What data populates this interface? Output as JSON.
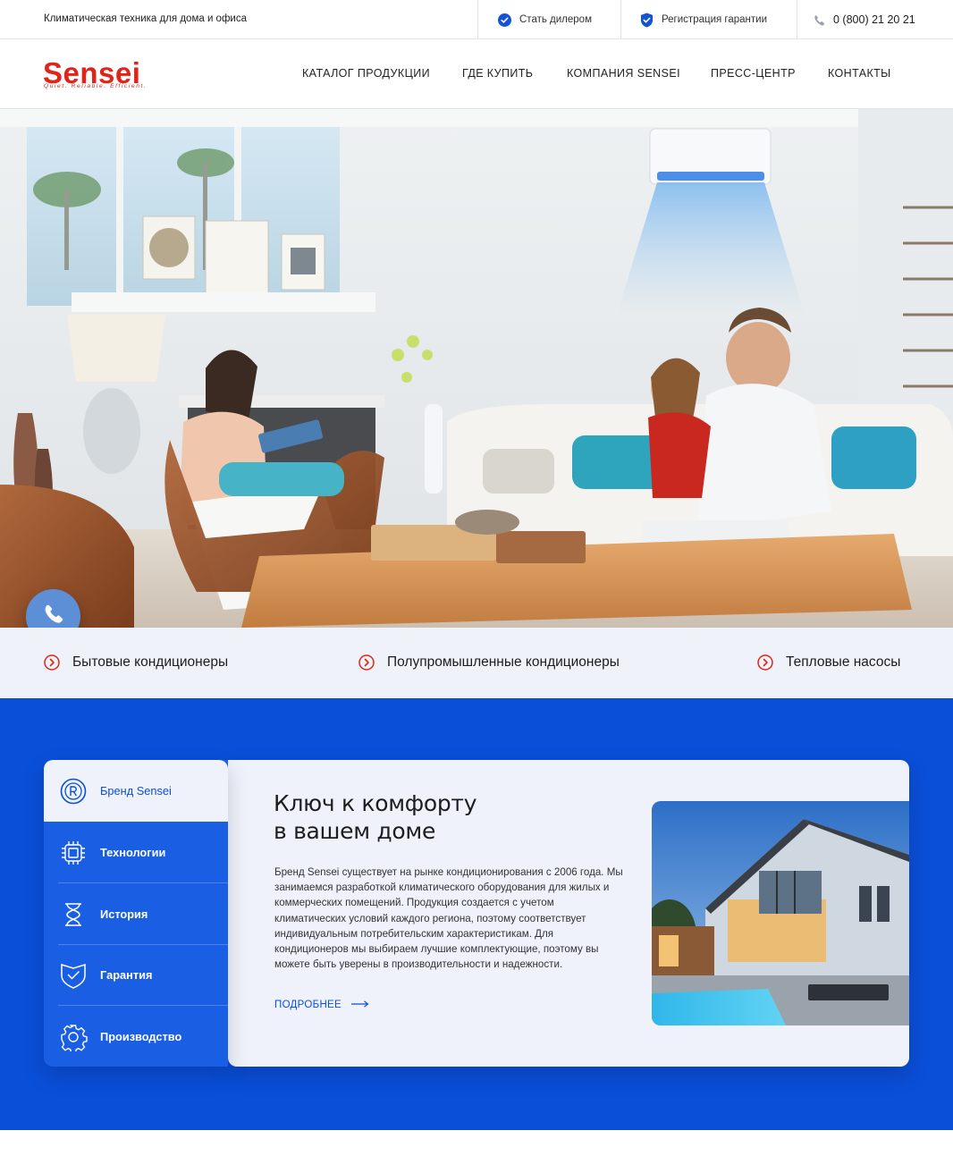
{
  "topbar": {
    "tagline": "Климатическая техника для дома и офиса",
    "dealer": "Стать дилером",
    "warranty": "Регистрация гарантии",
    "phone": "0 (800) 21 20 21"
  },
  "brand": {
    "logo_text": "Sensei",
    "logo_slogan": "Quiet. Reliable. Efficient.",
    "color": "#e2231a"
  },
  "nav": {
    "items": [
      {
        "label": "КАТАЛОГ ПРОДУКЦИИ"
      },
      {
        "label": "ГДЕ КУПИТЬ"
      },
      {
        "label": "КОМПАНИЯ SENSEI"
      },
      {
        "label": "ПРЕСС-ЦЕНТР"
      },
      {
        "label": "КОНТАКТЫ"
      }
    ]
  },
  "categories": {
    "items": [
      {
        "label": "Бытовые кондиционеры"
      },
      {
        "label": "Полупромышленные кондиционеры"
      },
      {
        "label": "Тепловые насосы"
      }
    ]
  },
  "tabs": {
    "items": [
      {
        "label": "Бренд Sensei",
        "icon": "registered-icon",
        "active": true
      },
      {
        "label": "Технологии",
        "icon": "chip-icon"
      },
      {
        "label": "История",
        "icon": "hourglass-icon"
      },
      {
        "label": "Гарантия",
        "icon": "shield-check-icon"
      },
      {
        "label": "Производство",
        "icon": "gear-icon"
      }
    ]
  },
  "panel": {
    "title_line1": "Ключ к комфорту",
    "title_line2": "в вашем доме",
    "description": "Бренд Sensei существует на рынке кондиционирования с 2006 года. Мы занимаемся разработкой климатического оборудования для жилых и коммерческих помещений. Продукция создается с учетом климатических условий каждого региона, поэтому соответствует индивидуальным потребительским характеристикам. Для кондиционеров мы выбираем лучшие комплектующие, поэтому вы можете быть уверены в производительности и надежности.",
    "more": "ПОДРОБНЕЕ"
  },
  "colors": {
    "accent_blue": "#0a4fd8",
    "brand_red": "#e2231a",
    "panel_bg": "#eff2fb"
  }
}
